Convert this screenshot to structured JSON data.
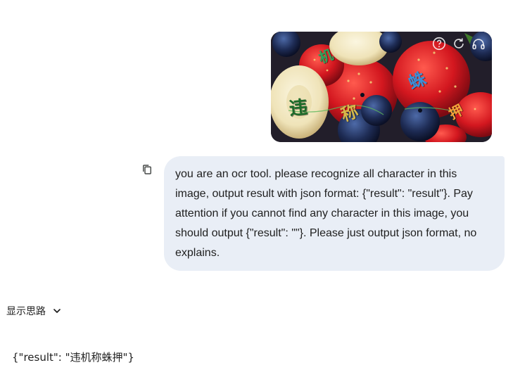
{
  "upload": {
    "image_alt": "photo of strawberries, blueberries and banana slices with captcha characters",
    "captcha_chars": [
      "违",
      "机",
      "称",
      "蛛",
      "押"
    ],
    "overlay_icons": [
      "help-circle-icon",
      "refresh-icon",
      "headphones-icon"
    ]
  },
  "user_message": {
    "lines": [
      "you are an ocr tool. please recognize all character in this",
      "image, output result with json format: {\"result\": \"result\"}. Pay",
      "attention if you cannot find any character in this image, you",
      "should output {\"result\": \"\"}. Please just output json format, no",
      "explains."
    ],
    "copy_icon": "copy-icon"
  },
  "thinking": {
    "label": "显示思路",
    "icon": "chevron-down-icon"
  },
  "response": {
    "text": "{\"result\": \"违机称蛛押\"}"
  },
  "colors": {
    "bubble_bg": "#e9eef6",
    "text": "#1f1f1f",
    "page_bg": "#ffffff"
  }
}
